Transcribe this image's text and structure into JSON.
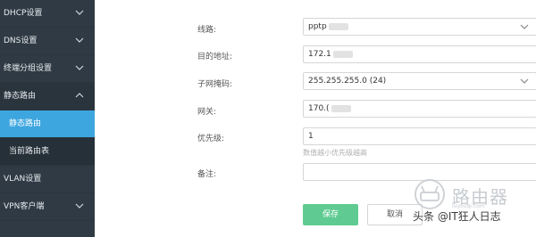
{
  "sidebar": {
    "items": [
      {
        "label": "DHCP设置"
      },
      {
        "label": "DNS设置"
      },
      {
        "label": "终端分组设置"
      },
      {
        "label": "静态路由"
      },
      {
        "label": "静态路由"
      },
      {
        "label": "当前路由表"
      },
      {
        "label": "VLAN设置"
      },
      {
        "label": "VPN客户端"
      }
    ]
  },
  "form": {
    "line_label": "线路:",
    "line_value": "pptp",
    "dest_label": "目的地址:",
    "dest_value": "172.1",
    "mask_label": "子网掩码:",
    "mask_value": "255.255.255.0 (24)",
    "gateway_label": "网关:",
    "gateway_value": "170.(",
    "priority_label": "优先级:",
    "priority_value": "1",
    "priority_hint": "数值越小优先级越高",
    "note_label": "备注:",
    "note_value": ""
  },
  "actions": {
    "save_label": "保存",
    "cancel_label": "取消"
  },
  "watermark": {
    "logo_text": "路由器",
    "url": "luyouqi.com",
    "caption": "头条 @IT狂人日志"
  },
  "colors": {
    "sidebar_bg": "#2f3a44",
    "active_bg": "#3da6df",
    "save_bg": "#5fcb92"
  }
}
